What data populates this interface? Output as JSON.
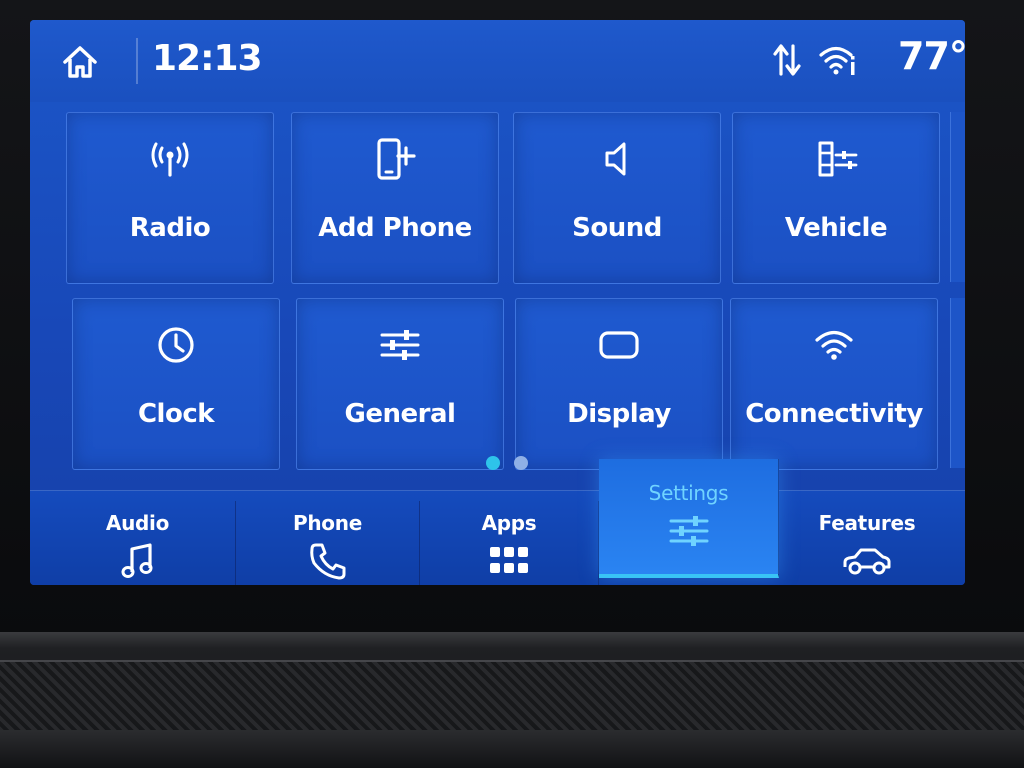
{
  "status_bar": {
    "home_icon": "home-icon",
    "time": "12:13",
    "data_icon": "data-transfer-icon",
    "wifi_icon": "wifi-info-icon",
    "temperature": "77°"
  },
  "tiles": [
    {
      "label": "Radio",
      "icon": "radio-antenna-icon"
    },
    {
      "label": "Add Phone",
      "icon": "add-phone-icon"
    },
    {
      "label": "Sound",
      "icon": "speaker-icon"
    },
    {
      "label": "Vehicle",
      "icon": "vehicle-settings-icon"
    },
    {
      "label": "Clock",
      "icon": "clock-icon"
    },
    {
      "label": "General",
      "icon": "sliders-icon"
    },
    {
      "label": "Display",
      "icon": "display-icon"
    },
    {
      "label": "Connectivity",
      "icon": "wifi-icon"
    }
  ],
  "pagination": {
    "pages": 2,
    "current": 1
  },
  "nav": [
    {
      "label": "Audio",
      "icon": "music-note-icon"
    },
    {
      "label": "Phone",
      "icon": "phone-handset-icon"
    },
    {
      "label": "Apps",
      "icon": "apps-grid-icon"
    },
    {
      "label": "Settings",
      "icon": "settings-sliders-icon",
      "active": true
    },
    {
      "label": "Features",
      "icon": "car-icon"
    }
  ],
  "colors": {
    "screen_blue": "#1c57c9",
    "active_tab": "#2a84f2",
    "active_accent": "#39c4f5",
    "dot_active": "#2ec4ea"
  }
}
